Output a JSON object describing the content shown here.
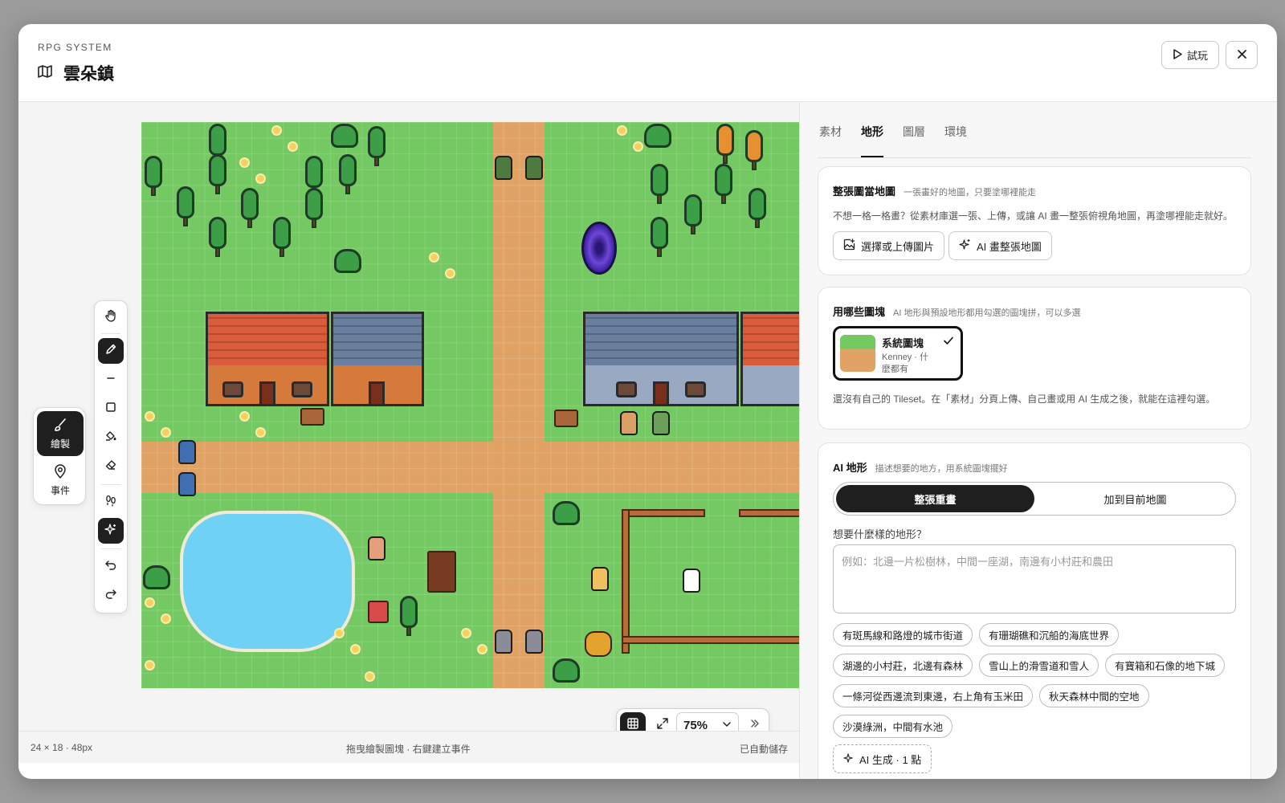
{
  "header": {
    "eyebrow": "RPG SYSTEM",
    "title": "雲朵鎮",
    "play_label": "試玩"
  },
  "modes": [
    {
      "label": "繪製",
      "icon": "brush-icon"
    },
    {
      "label": "事件",
      "icon": "map-pin-icon"
    }
  ],
  "tools": [
    "hand-icon",
    "pencil-icon",
    "line-icon",
    "rectangle-icon",
    "bucket-icon",
    "eraser-icon",
    "footprints-icon",
    "sparkle-icon",
    "undo-icon",
    "redo-icon"
  ],
  "zoom": {
    "value": "75%"
  },
  "status": {
    "size": "24 × 18 · 48px",
    "hint": "拖曳繪製圖塊 · 右鍵建立事件",
    "saved": "已自動儲存"
  },
  "tabs": [
    {
      "label": "素材"
    },
    {
      "label": "地形",
      "active": true
    },
    {
      "label": "圖層"
    },
    {
      "label": "環境"
    }
  ],
  "card_whole": {
    "title": "整張圖當地圖",
    "subtitle": "一張畫好的地圖，只要塗哪裡能走",
    "desc": "不想一格一格畫？從素材庫選一張、上傳，或讓 AI 畫一整張俯視角地圖，再塗哪裡能走就好。",
    "btn_upload": "選擇或上傳圖片",
    "btn_ai": "AI 畫整張地圖"
  },
  "card_tiles": {
    "title": "用哪些圖塊",
    "subtitle": "AI 地形與預設地形都用勾選的圖塊拼，可以多選",
    "tile_name": "系統圖塊",
    "tile_desc_1": "Kenney · 什",
    "tile_desc_2": "麼都有",
    "note": "還沒有自己的 Tileset。在「素材」分頁上傳、自己畫或用 AI 生成之後，就能在這裡勾選。"
  },
  "card_ai": {
    "title": "AI 地形",
    "subtitle": "描述想要的地方，用系統圖塊擺好",
    "seg_replace": "整張重畫",
    "seg_add": "加到目前地圖",
    "field_label": "想要什麼樣的地形？",
    "placeholder": "例如：北邊一片松樹林，中間一座湖，南邊有小村莊和農田",
    "chips": [
      "有斑馬線和路燈的城市街道",
      "有珊瑚礁和沉船的海底世界",
      "湖邊的小村莊，北邊有森林",
      "雪山上的滑雪道和雪人",
      "有寶箱和石像的地下城",
      "一條河從西邊流到東邊，右上角有玉米田",
      "秋天森林中間的空地",
      "沙漠綠洲，中間有水池"
    ],
    "generate_label": "AI 生成 · 1 點"
  },
  "colors": {
    "grass": "#74c962",
    "road": "#e0a365",
    "water": "#6fd1f3",
    "accent": "#1f1f1f"
  }
}
